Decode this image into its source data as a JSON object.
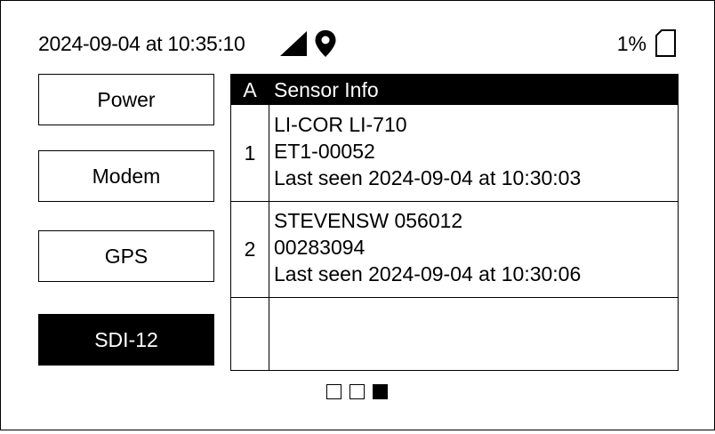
{
  "status": {
    "datetime": "2024-09-04 at 10:35:10",
    "battery": "1%",
    "icons": [
      "signal-icon",
      "location-pin-icon",
      "battery-icon"
    ]
  },
  "menu": {
    "items": [
      {
        "label": "Power",
        "active": false
      },
      {
        "label": "Modem",
        "active": false
      },
      {
        "label": "GPS",
        "active": false
      },
      {
        "label": "SDI-12",
        "active": true
      }
    ]
  },
  "table": {
    "headers": [
      "A",
      "Sensor Info"
    ],
    "rows": [
      {
        "num": "1",
        "lines": [
          "LI-COR LI-710",
          "ET1-00052",
          "Last seen 2024-09-04 at 10:30:03"
        ]
      },
      {
        "num": "2",
        "lines": [
          "STEVENSW 056012",
          "00283094",
          "Last seen 2024-09-04 at 10:30:06"
        ]
      },
      {
        "num": "",
        "lines": [
          "",
          "",
          ""
        ]
      }
    ]
  },
  "pager": {
    "pages": 3,
    "current": 3
  },
  "colors": {
    "foreground": "#000000",
    "background": "#ffffff"
  }
}
